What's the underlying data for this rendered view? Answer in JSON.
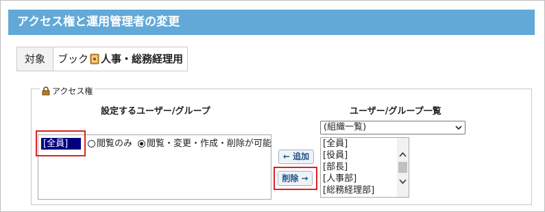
{
  "title": "アクセス権と運用管理者の変更",
  "target": {
    "label": "対象",
    "book_label": "ブック",
    "book_name": "人事・総務経理用",
    "icon": "book-icon"
  },
  "access": {
    "legend": "アクセス権",
    "legend_icon": "lock-icon",
    "set_header": "設定するユーザー/グループ",
    "list_header": "ユーザー/グループ一覧",
    "selected_member": "[全員]",
    "permission_options": [
      {
        "label": "閲覧のみ",
        "checked": false
      },
      {
        "label": "閲覧・変更・作成・削除が可能",
        "checked": true
      }
    ],
    "add_button": "← 追加",
    "remove_button": "削除 →",
    "group_select": "(組織一覧)",
    "users": [
      "[全員]",
      "[役員]",
      "[部長]",
      "[人事部]",
      "[総務経理部]"
    ]
  },
  "colors": {
    "title_bar": "#62a9d8",
    "highlight": "#e02020",
    "selected_bg": "#000080"
  }
}
